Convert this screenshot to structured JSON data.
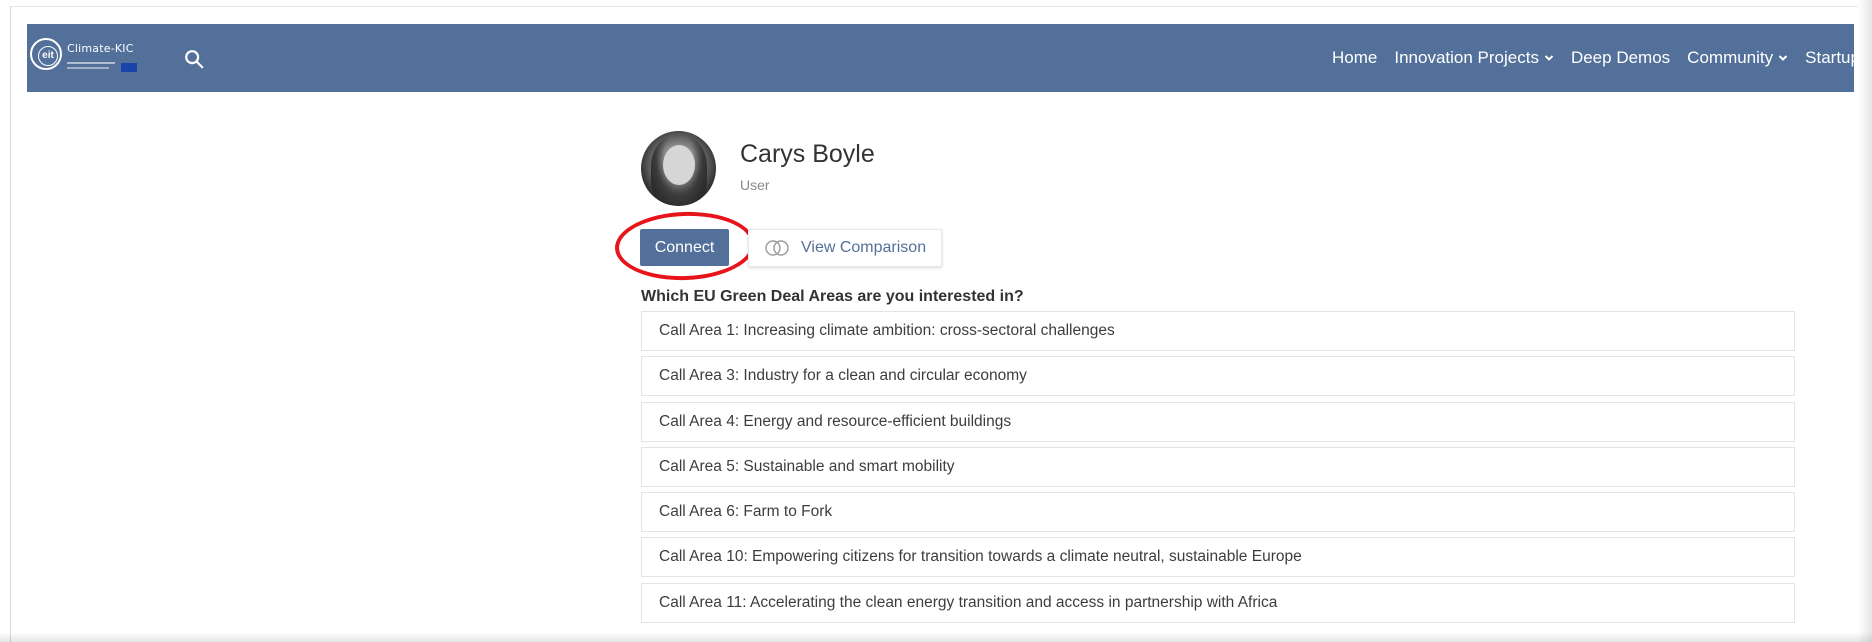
{
  "header": {
    "logo_text": "Climate-KIC",
    "logo_mark": "eit",
    "nav": [
      {
        "label": "Home",
        "has_dropdown": false
      },
      {
        "label": "Innovation Projects",
        "has_dropdown": true
      },
      {
        "label": "Deep Demos",
        "has_dropdown": false
      },
      {
        "label": "Community",
        "has_dropdown": true
      },
      {
        "label": "Startup",
        "has_dropdown": false
      }
    ]
  },
  "profile": {
    "name": "Carys Boyle",
    "role": "User",
    "connect_label": "Connect",
    "compare_label": "View Comparison"
  },
  "interests": {
    "question": "Which EU Green Deal Areas are you interested in?",
    "items": [
      "Call Area 1: Increasing climate ambition: cross-sectoral challenges",
      "Call Area 3: Industry for a clean and circular economy",
      "Call Area 4: Energy and resource-efficient buildings",
      "Call Area 5: Sustainable and smart mobility",
      "Call Area 6: Farm to Fork",
      "Call Area 10: Empowering citizens for transition towards a climate neutral, sustainable Europe",
      "Call Area 11: Accelerating the clean energy transition and access in partnership with Africa"
    ]
  },
  "colors": {
    "navbar": "#52709a",
    "accent": "#52709a",
    "highlight": "#e8141b"
  },
  "icons": {
    "search": "search-icon",
    "dropdown": "chevron-down-icon",
    "compare": "overlap-circles-icon"
  }
}
